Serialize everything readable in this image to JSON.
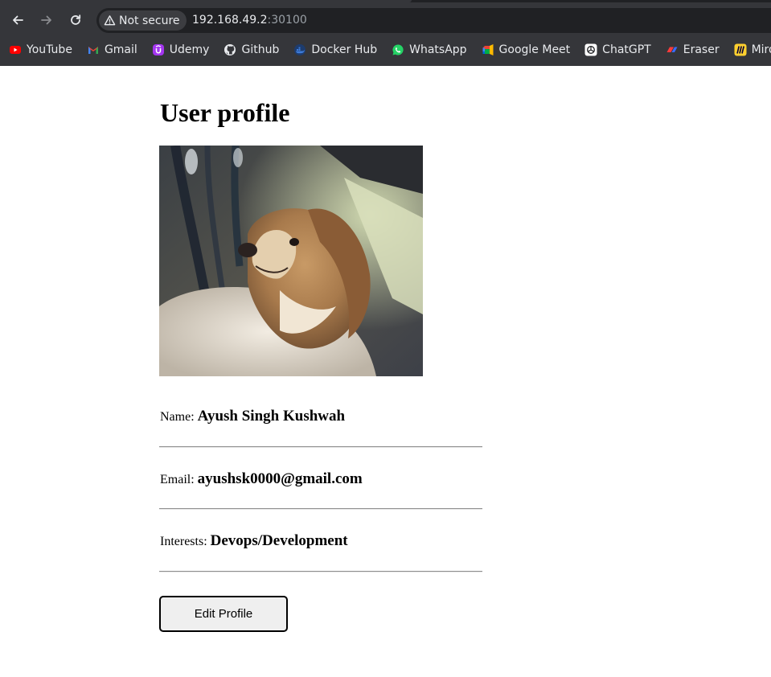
{
  "browser": {
    "security_label": "Not secure",
    "url_host": "192.168.49.2",
    "url_port": ":30100",
    "bookmarks": [
      {
        "label": "YouTube",
        "icon": "youtube-icon",
        "color": "#ff0000"
      },
      {
        "label": "Gmail",
        "icon": "gmail-icon",
        "color": "#ea4335"
      },
      {
        "label": "Udemy",
        "icon": "udemy-icon",
        "color": "#a435f0"
      },
      {
        "label": "Github",
        "icon": "github-icon",
        "color": "#ffffff"
      },
      {
        "label": "Docker Hub",
        "icon": "docker-icon",
        "color": "#1d63ed"
      },
      {
        "label": "WhatsApp",
        "icon": "whatsapp-icon",
        "color": "#25d366"
      },
      {
        "label": "Google Meet",
        "icon": "google-meet-icon",
        "color": "#00ac47"
      },
      {
        "label": "ChatGPT",
        "icon": "chatgpt-icon",
        "color": "#ffffff"
      },
      {
        "label": "Eraser",
        "icon": "eraser-icon",
        "color": "#ff3a3a"
      },
      {
        "label": "Miro",
        "icon": "miro-icon",
        "color": "#ffd02f"
      }
    ]
  },
  "profile": {
    "title": "User profile",
    "photo_icon": "dog-photo",
    "name_label": "Name:",
    "name_value": "Ayush Singh Kushwah",
    "email_label": "Email:",
    "email_value": "ayushsk0000@gmail.com",
    "interests_label": "Interests:",
    "interests_value": "Devops/Development",
    "edit_button": "Edit Profile"
  }
}
